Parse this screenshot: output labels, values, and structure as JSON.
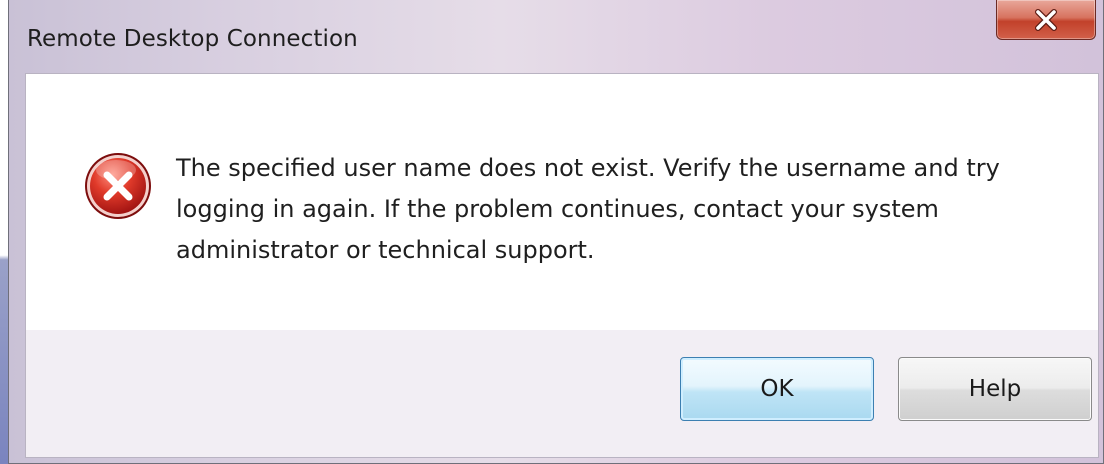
{
  "window": {
    "title": "Remote Desktop Connection"
  },
  "titlebar": {
    "close_icon": "close-icon"
  },
  "message": {
    "icon": "error-icon",
    "line1": "The specified user name does not exist. Verify the username and try",
    "line2": "logging in again. If the problem continues, contact your system",
    "line3": "administrator or technical support."
  },
  "buttons": {
    "ok_label": "OK",
    "help_label": "Help"
  },
  "colors": {
    "close_button": "#c94a34",
    "error_red": "#cc2a2a",
    "ok_border": "#3c7fb1",
    "button_panel": "#f2eef4"
  }
}
